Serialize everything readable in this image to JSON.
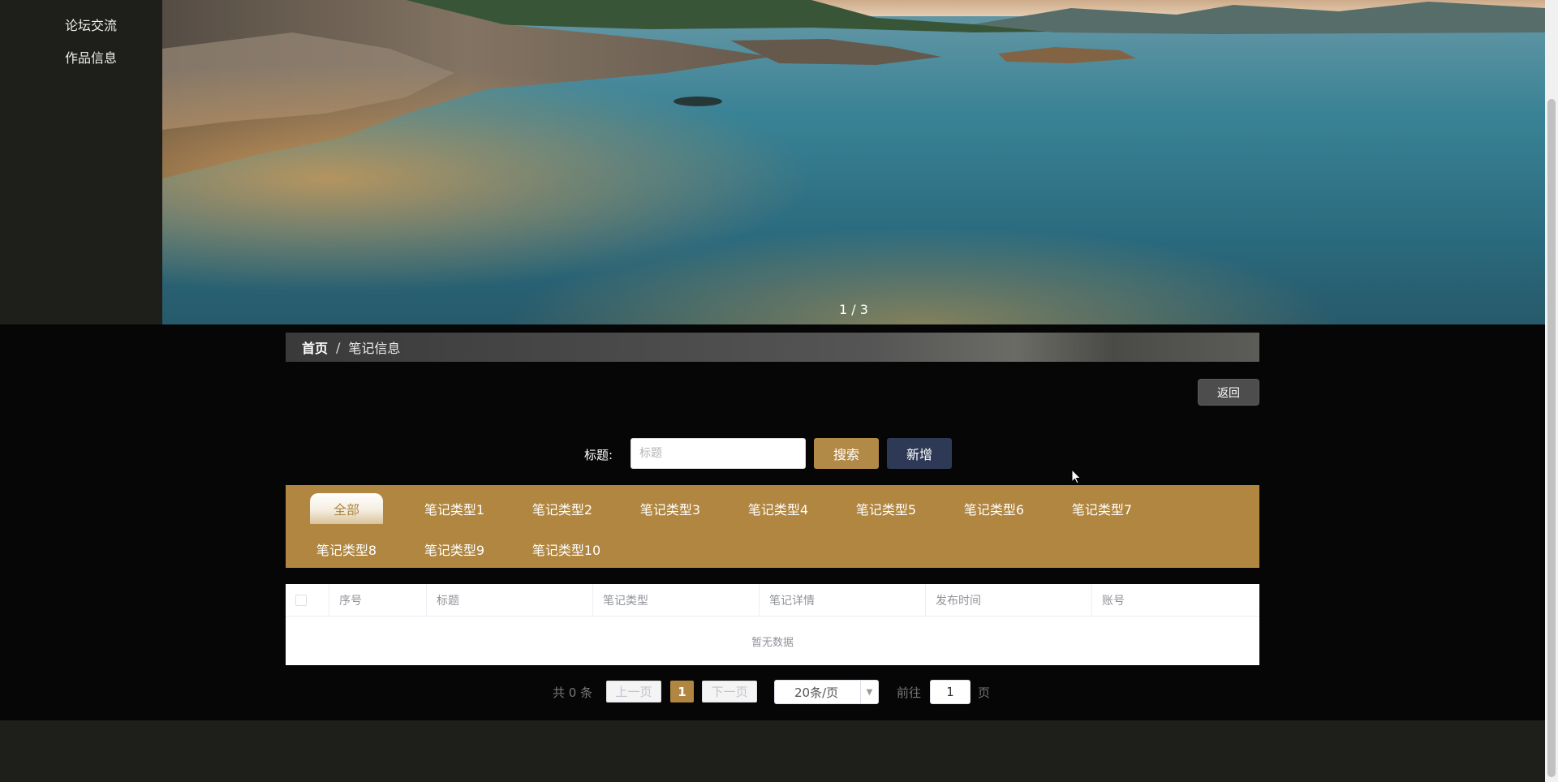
{
  "sidenav": {
    "items": [
      {
        "label": "论坛交流"
      },
      {
        "label": "作品信息"
      }
    ]
  },
  "banner": {
    "indicator": "1 / 3"
  },
  "breadcrumb": {
    "home": "首页",
    "separator": "/",
    "current": "笔记信息"
  },
  "actions": {
    "back_label": "返回"
  },
  "search": {
    "label": "标题:",
    "placeholder": "标题",
    "value": "",
    "search_label": "搜索",
    "add_label": "新增"
  },
  "tabs": [
    {
      "label": "全部",
      "active": true
    },
    {
      "label": "笔记类型1"
    },
    {
      "label": "笔记类型2"
    },
    {
      "label": "笔记类型3"
    },
    {
      "label": "笔记类型4"
    },
    {
      "label": "笔记类型5"
    },
    {
      "label": "笔记类型6"
    },
    {
      "label": "笔记类型7"
    },
    {
      "label": "笔记类型8"
    },
    {
      "label": "笔记类型9"
    },
    {
      "label": "笔记类型10"
    }
  ],
  "table": {
    "columns": [
      "序号",
      "标题",
      "笔记类型",
      "笔记详情",
      "发布时间",
      "账号"
    ],
    "empty_text": "暂无数据"
  },
  "pager": {
    "total": "共 0 条",
    "prev_label": "上一页",
    "next_label": "下一页",
    "current_page": "1",
    "page_size": "20条/页",
    "goto_label": "前往",
    "goto_value": "1",
    "goto_suffix": "页"
  },
  "colors": {
    "accent_gold": "#b08640",
    "add_button": "#2e3a55",
    "sidebar_bg": "#1e1e1a",
    "page_bg": "#060606"
  }
}
